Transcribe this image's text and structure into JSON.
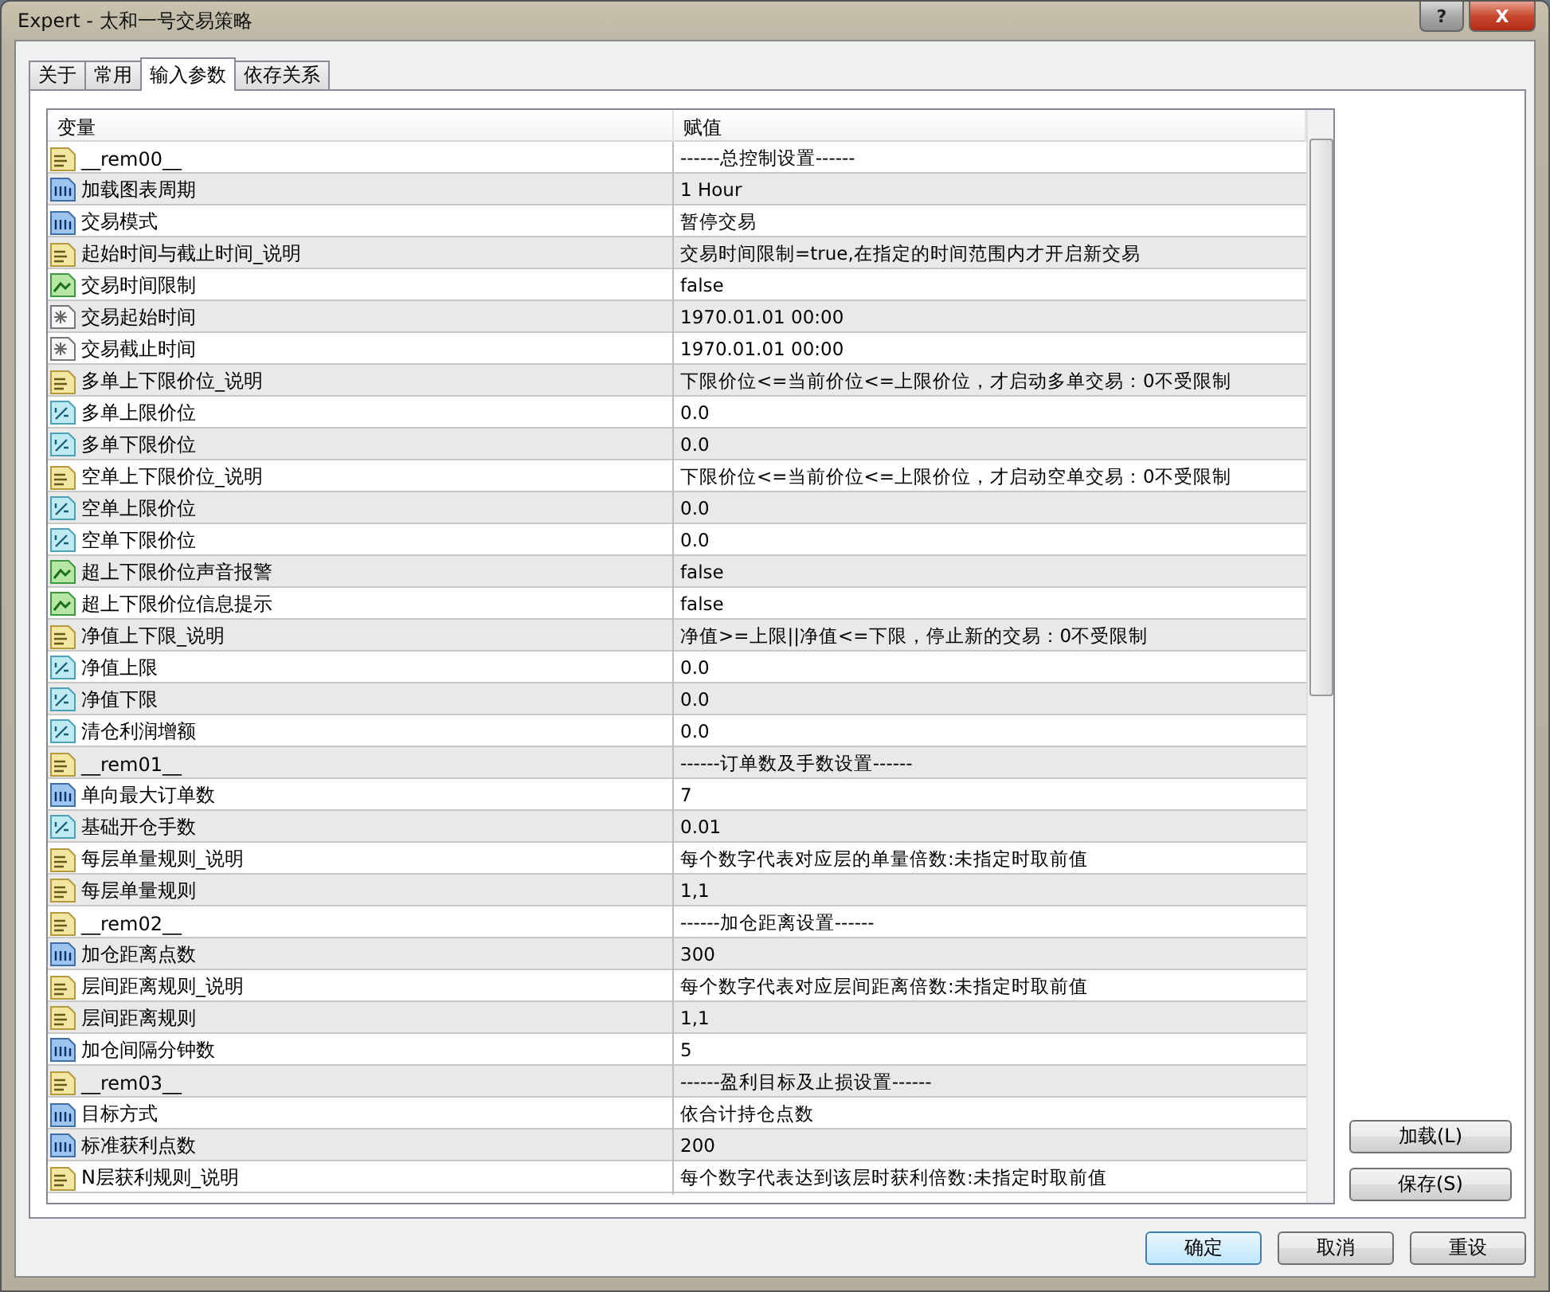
{
  "window": {
    "title": "Expert - 太和一号交易策略",
    "help": "?",
    "close": "X"
  },
  "tabs": [
    {
      "label": "关于",
      "selected": false
    },
    {
      "label": "常用",
      "selected": false
    },
    {
      "label": "输入参数",
      "selected": true
    },
    {
      "label": "依存关系",
      "selected": false
    }
  ],
  "table": {
    "columns": [
      "变量",
      "赋值"
    ],
    "rows": [
      {
        "kind": "text",
        "name": "__rem00__",
        "value": "------总控制设置------"
      },
      {
        "kind": "int",
        "name": "加载图表周期",
        "value": "1 Hour"
      },
      {
        "kind": "int",
        "name": "交易模式",
        "value": "暂停交易"
      },
      {
        "kind": "text",
        "name": "起始时间与截止时间_说明",
        "value": "交易时间限制=true,在指定的时间范围内才开启新交易"
      },
      {
        "kind": "bool",
        "name": "交易时间限制",
        "value": "false"
      },
      {
        "kind": "datetime",
        "name": "交易起始时间",
        "value": "1970.01.01 00:00"
      },
      {
        "kind": "datetime",
        "name": "交易截止时间",
        "value": "1970.01.01 00:00"
      },
      {
        "kind": "text",
        "name": "多单上下限价位_说明",
        "value": "下限价位<=当前价位<=上限价位，才启动多单交易：0不受限制"
      },
      {
        "kind": "double",
        "name": "多单上限价位",
        "value": "0.0"
      },
      {
        "kind": "double",
        "name": "多单下限价位",
        "value": "0.0"
      },
      {
        "kind": "text",
        "name": "空单上下限价位_说明",
        "value": "下限价位<=当前价位<=上限价位，才启动空单交易：0不受限制"
      },
      {
        "kind": "double",
        "name": "空单上限价位",
        "value": "0.0"
      },
      {
        "kind": "double",
        "name": "空单下限价位",
        "value": "0.0"
      },
      {
        "kind": "bool",
        "name": "超上下限价位声音报警",
        "value": "false"
      },
      {
        "kind": "bool",
        "name": "超上下限价位信息提示",
        "value": "false"
      },
      {
        "kind": "text",
        "name": "净值上下限_说明",
        "value": "净值>=上限||净值<=下限，停止新的交易：0不受限制"
      },
      {
        "kind": "double",
        "name": "净值上限",
        "value": "0.0"
      },
      {
        "kind": "double",
        "name": "净值下限",
        "value": "0.0"
      },
      {
        "kind": "double",
        "name": "清仓利润增额",
        "value": "0.0"
      },
      {
        "kind": "text",
        "name": "__rem01__",
        "value": "------订单数及手数设置------"
      },
      {
        "kind": "int",
        "name": "单向最大订单数",
        "value": "7"
      },
      {
        "kind": "double",
        "name": "基础开仓手数",
        "value": "0.01"
      },
      {
        "kind": "text",
        "name": "每层单量规则_说明",
        "value": "每个数字代表对应层的单量倍数:未指定时取前值"
      },
      {
        "kind": "text",
        "name": "每层单量规则",
        "value": "1,1"
      },
      {
        "kind": "text",
        "name": "__rem02__",
        "value": "------加仓距离设置------"
      },
      {
        "kind": "int",
        "name": "加仓距离点数",
        "value": "300"
      },
      {
        "kind": "text",
        "name": "层间距离规则_说明",
        "value": "每个数字代表对应层间距离倍数:未指定时取前值"
      },
      {
        "kind": "text",
        "name": "层间距离规则",
        "value": "1,1"
      },
      {
        "kind": "int",
        "name": "加仓间隔分钟数",
        "value": "5"
      },
      {
        "kind": "text",
        "name": "__rem03__",
        "value": "------盈利目标及止损设置------"
      },
      {
        "kind": "int",
        "name": "目标方式",
        "value": "依合计持仓点数"
      },
      {
        "kind": "int",
        "name": "标准获利点数",
        "value": "200"
      },
      {
        "kind": "text",
        "name": "N层获利规则_说明",
        "value": "每个数字代表达到该层时获利倍数:未指定时取前值"
      }
    ]
  },
  "side_buttons": [
    "加载(L)",
    "保存(S)"
  ],
  "buttons": [
    {
      "label": "确定",
      "default": true
    },
    {
      "label": "取消",
      "default": false
    },
    {
      "label": "重设",
      "default": false
    }
  ]
}
